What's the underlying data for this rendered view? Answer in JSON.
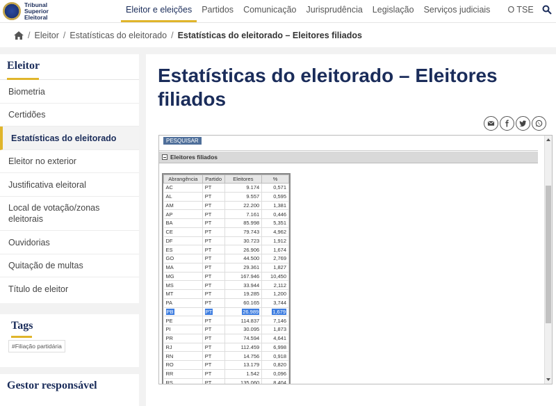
{
  "header": {
    "logo_lines": [
      "Tribunal",
      "Superior",
      "Eleitoral"
    ],
    "nav": [
      "Eleitor e eleições",
      "Partidos",
      "Comunicação",
      "Jurisprudência",
      "Legislação",
      "Serviços judiciais",
      "O TSE"
    ],
    "active_nav": "Eleitor e eleições"
  },
  "breadcrumb": [
    "Eleitor",
    "Estatísticas do eleitorado",
    "Estatísticas do eleitorado – Eleitores filiados"
  ],
  "sidebar": {
    "title": "Eleitor",
    "items": [
      "Biometria",
      "Certidões",
      "Estatísticas do eleitorado",
      "Eleitor no exterior",
      "Justificativa eleitoral",
      "Local de votação/zonas eleitorais",
      "Ouvidorias",
      "Quitação de multas",
      "Título de eleitor"
    ],
    "active_item": "Estatísticas do eleitorado",
    "tags_title": "Tags",
    "tags": [
      "#Filiação partidária"
    ],
    "gestor_title": "Gestor responsável"
  },
  "main": {
    "title": "Estatísticas do eleitorado – Eleitores filiados",
    "share_icons": [
      "email-icon",
      "facebook-icon",
      "twitter-icon",
      "whatsapp-icon"
    ],
    "frame": {
      "search_button": "PESQUISAR",
      "panel_title": "Eleitores filiados",
      "columns": [
        "Abrangência",
        "Partido",
        "Eleitores",
        "%"
      ],
      "rows": [
        [
          "AC",
          "PT",
          "9.174",
          "0,571"
        ],
        [
          "AL",
          "PT",
          "9.557",
          "0,595"
        ],
        [
          "AM",
          "PT",
          "22.200",
          "1,381"
        ],
        [
          "AP",
          "PT",
          "7.161",
          "0,446"
        ],
        [
          "BA",
          "PT",
          "85.998",
          "5,351"
        ],
        [
          "CE",
          "PT",
          "79.743",
          "4,962"
        ],
        [
          "DF",
          "PT",
          "30.723",
          "1,912"
        ],
        [
          "ES",
          "PT",
          "26.906",
          "1,674"
        ],
        [
          "GO",
          "PT",
          "44.500",
          "2,769"
        ],
        [
          "MA",
          "PT",
          "29.361",
          "1,827"
        ],
        [
          "MG",
          "PT",
          "167.946",
          "10,450"
        ],
        [
          "MS",
          "PT",
          "33.944",
          "2,112"
        ],
        [
          "MT",
          "PT",
          "19.285",
          "1,200"
        ],
        [
          "PA",
          "PT",
          "60.165",
          "3,744"
        ],
        [
          "PB",
          "PT",
          "26.989",
          "1,679"
        ],
        [
          "PE",
          "PT",
          "114.837",
          "7,146"
        ],
        [
          "PI",
          "PT",
          "30.095",
          "1,873"
        ],
        [
          "PR",
          "PT",
          "74.594",
          "4,641"
        ],
        [
          "RJ",
          "PT",
          "112.459",
          "6,998"
        ],
        [
          "RN",
          "PT",
          "14.756",
          "0,918"
        ],
        [
          "RO",
          "PT",
          "13.179",
          "0,820"
        ],
        [
          "RR",
          "PT",
          "1.542",
          "0,096"
        ],
        [
          "RS",
          "PT",
          "135.060",
          "8,404"
        ]
      ],
      "highlighted_row": "PB"
    }
  }
}
